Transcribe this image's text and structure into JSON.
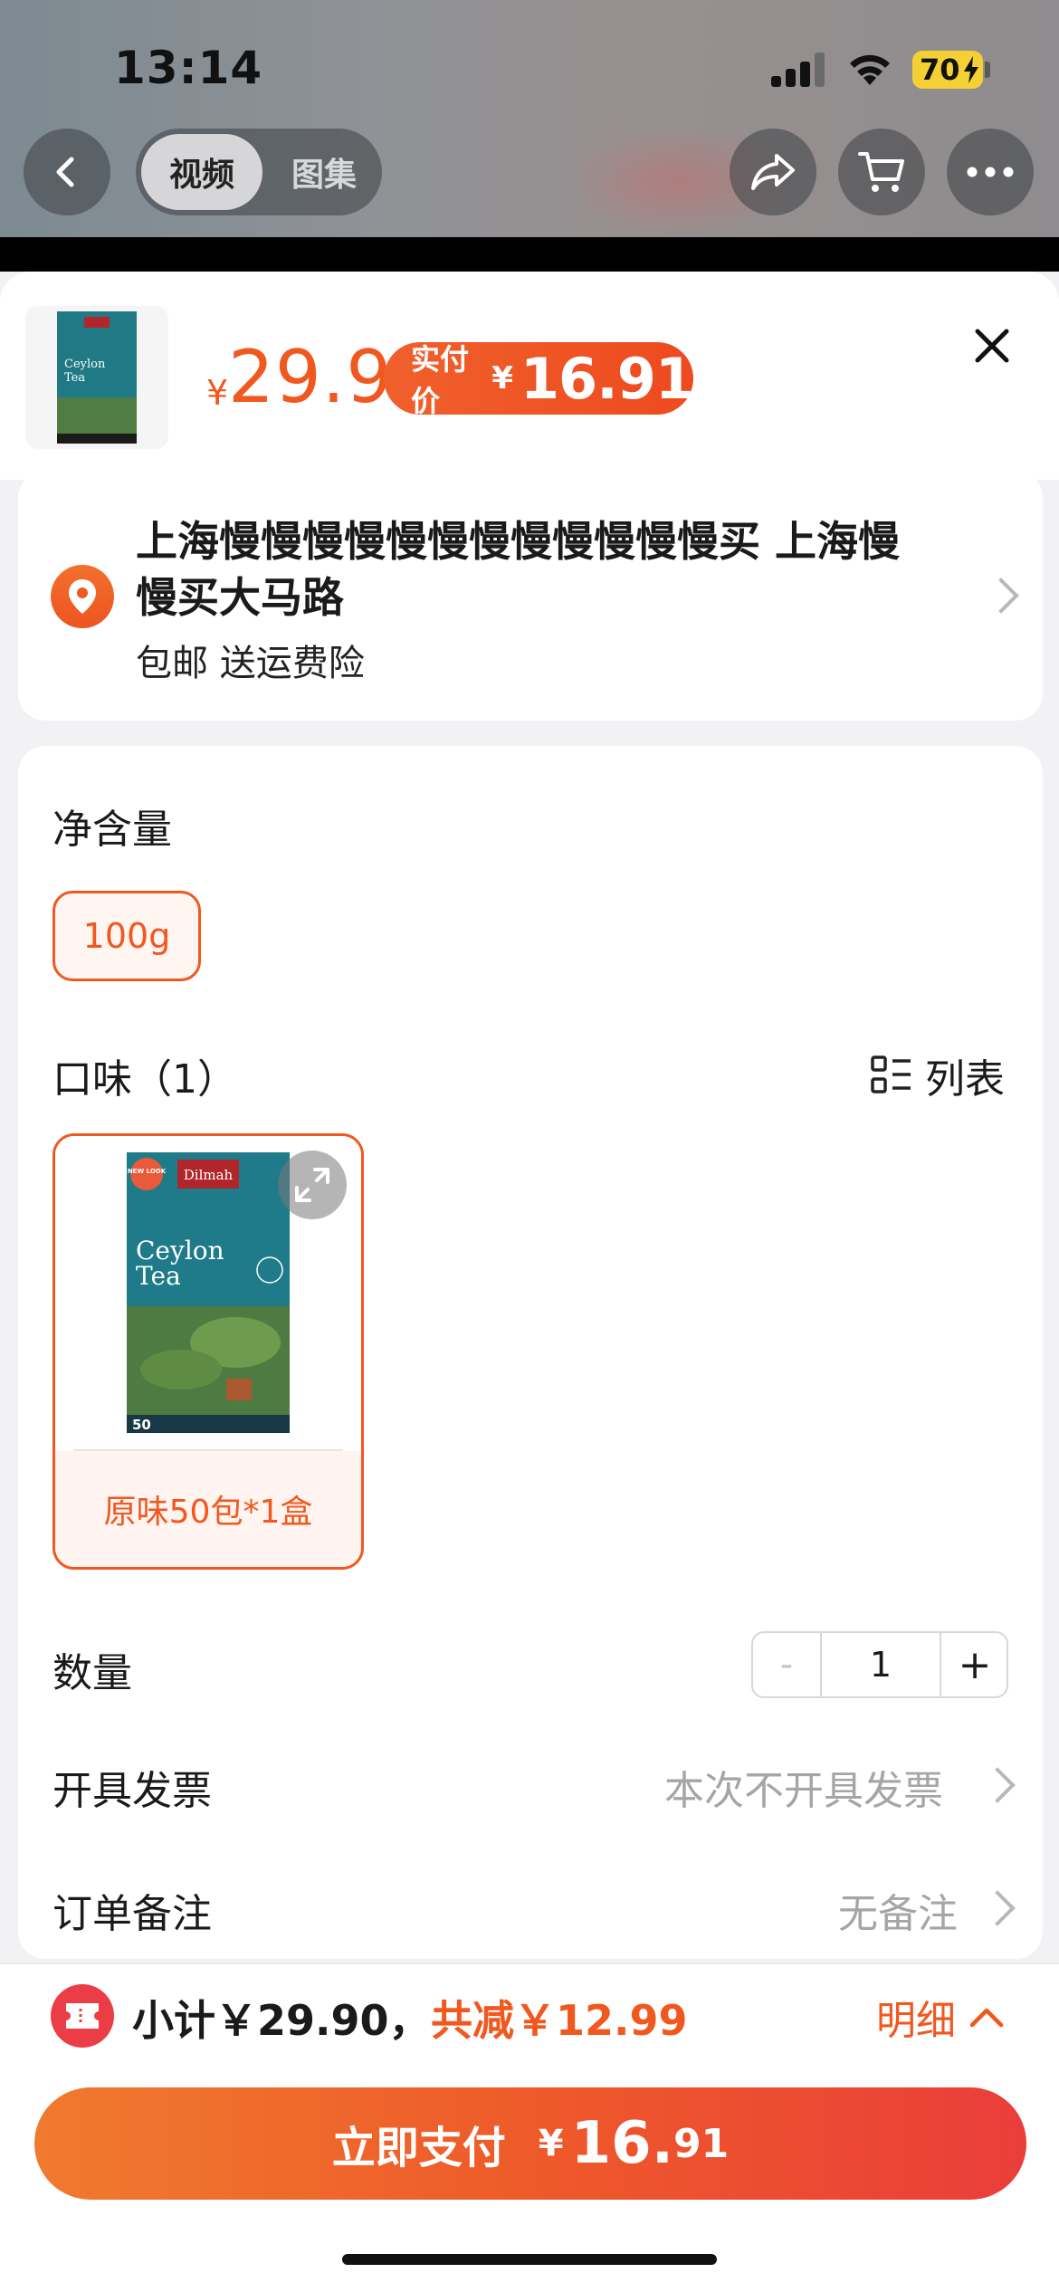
{
  "status_bar": {
    "time": "13:14",
    "battery": "70"
  },
  "nav": {
    "tabs": [
      "视频",
      "图集"
    ]
  },
  "product": {
    "price_symbol": "¥",
    "price": "29.9",
    "paid_label": "实付价",
    "paid_symbol": "¥",
    "paid_price": "16.91"
  },
  "address": {
    "line1": "上海慢慢慢慢慢慢慢慢慢慢慢慢买 上海慢",
    "line2": "慢买大马路",
    "tags": "包邮  送运费险"
  },
  "spec": {
    "net_title": "净含量",
    "net_option": "100g",
    "flavor_title": "口味（1）",
    "list_label": "列表",
    "flavor_option": "原味50包*1盒",
    "image_text": {
      "badge": "NEW LOOK",
      "brand": "Dilmah",
      "name1": "Ceylon",
      "name2": "Tea",
      "count": "50"
    }
  },
  "rows": {
    "quantity_label": "数量",
    "quantity_value": "1",
    "quantity_minus": "-",
    "quantity_plus": "+",
    "invoice_label": "开具发票",
    "invoice_value": "本次不开具发票",
    "remark_label": "订单备注",
    "remark_value": "无备注"
  },
  "footer": {
    "subtotal": "小计￥29.90，",
    "discount": "共减￥12.99",
    "detail": "明细",
    "pay_label": "立即支付",
    "pay_symbol": "¥",
    "pay_int": "16.",
    "pay_dec": "91"
  },
  "colors": {
    "accent": "#f1581f",
    "coupon": "#ea3d46"
  }
}
